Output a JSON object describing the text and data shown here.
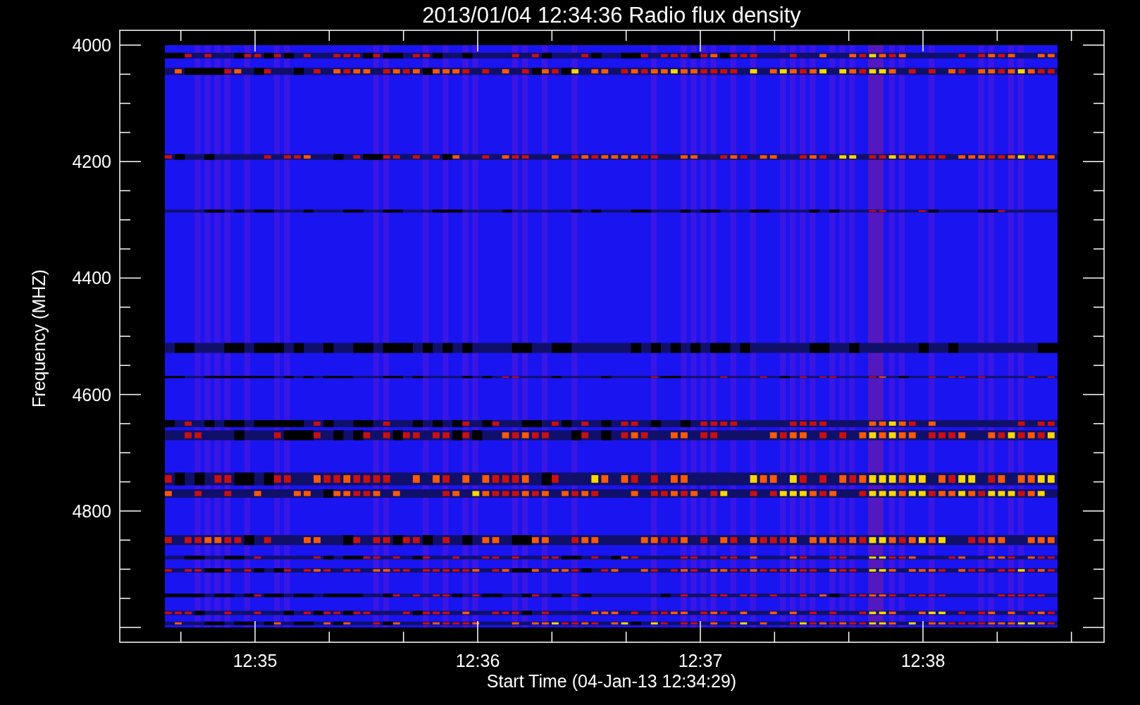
{
  "title": "2013/01/04 12:34:36 Radio flux density",
  "y_axis": {
    "label": "Frequency (MHZ)",
    "ticks": [
      "4000",
      "4200",
      "4400",
      "4600",
      "4800"
    ]
  },
  "x_axis": {
    "label": "Start Time (04-Jan-13 12:34:29)",
    "ticks": [
      "12:35",
      "12:36",
      "12:37",
      "12:38"
    ]
  }
}
